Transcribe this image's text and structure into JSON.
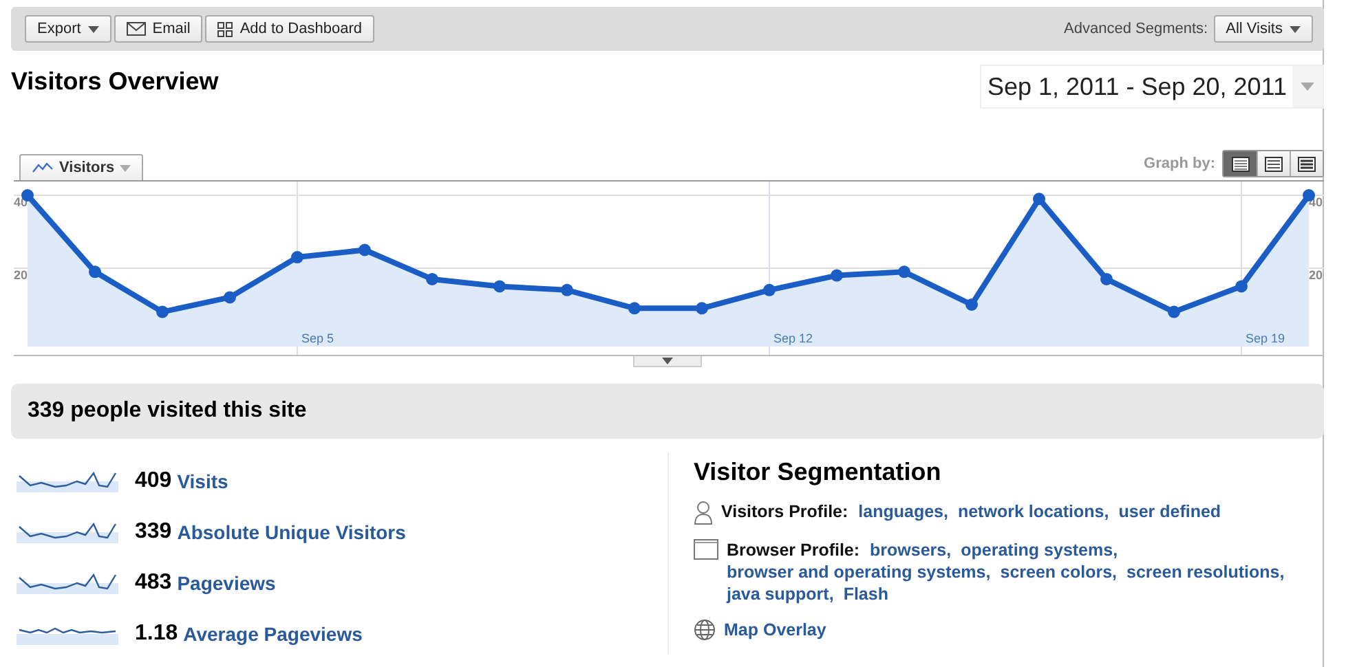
{
  "toolbar": {
    "buttons": [
      {
        "label": "Export",
        "kind": "dropdown"
      },
      {
        "label": "Email",
        "kind": "email"
      },
      {
        "label": "Add to Dashboard",
        "kind": "dashboard"
      }
    ],
    "segments_label": "Advanced Segments:",
    "segments_value": "All Visits"
  },
  "title": "Visitors Overview",
  "date_range": "Sep 1, 2011 - Sep 20, 2011",
  "graph": {
    "graph_by_label": "Graph by:",
    "graph_by_options": [
      {
        "kind": "day",
        "selected": true
      },
      {
        "kind": "week",
        "selected": false
      },
      {
        "kind": "month",
        "selected": false
      }
    ],
    "chart_data": {
      "type": "area",
      "categories": [
        null,
        null,
        null,
        null,
        "Sep 5",
        null,
        null,
        null,
        null,
        null,
        null,
        "Sep 12",
        null,
        null,
        null,
        null,
        null,
        null,
        "Sep 19",
        null
      ],
      "series": [
        {
          "name": "Visitors",
          "color": "#1a5ec5",
          "values": [
            40,
            19,
            8,
            12,
            23,
            25,
            17,
            15,
            14,
            9,
            9,
            14,
            18,
            19,
            10,
            39,
            17,
            8,
            15,
            40
          ]
        }
      ],
      "ylim": [
        0,
        40
      ],
      "yticks": [
        {
          "value": 20,
          "label": "20"
        },
        {
          "value": 40,
          "label": "40"
        }
      ]
    }
  },
  "summary": {
    "headline": "339 people visited this site",
    "metrics": [
      {
        "value": "409",
        "label": "Visits",
        "kind": "spiky"
      },
      {
        "value": "339",
        "label": "Absolute Unique Visitors",
        "kind": "spiky"
      },
      {
        "value": "483",
        "label": "Pageviews",
        "kind": "spiky"
      },
      {
        "value": "1.18",
        "label": "Average Pageviews",
        "kind": "flat"
      }
    ]
  },
  "segmentation": {
    "title": "Visitor Segmentation",
    "separator": ",",
    "groups": [
      {
        "kind": "person",
        "label": "Visitors Profile:",
        "links": [
          "languages",
          "network locations",
          "user defined"
        ]
      },
      {
        "kind": "browser",
        "label": "Browser Profile:",
        "links": [
          "browsers",
          "operating systems",
          "browser and operating systems",
          "screen colors",
          "screen resolutions",
          "java support",
          "Flash"
        ]
      },
      {
        "kind": "map",
        "links": [
          "Map Overlay"
        ]
      }
    ]
  }
}
